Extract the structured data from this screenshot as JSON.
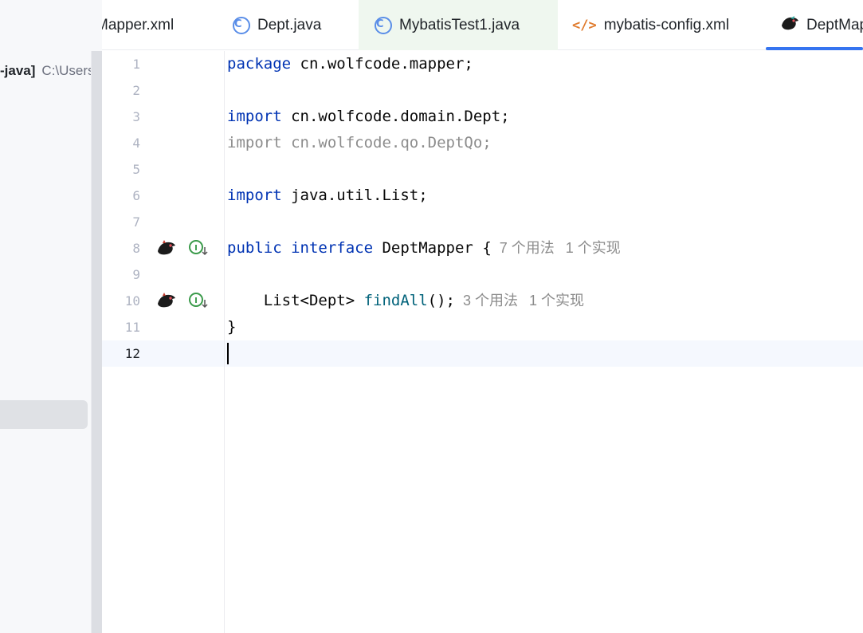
{
  "sidebar": {
    "project_name": "-java]",
    "project_path": "C:\\Users\\"
  },
  "tabs": [
    {
      "label": "Mapper.xml",
      "icon": "xml-file-icon"
    },
    {
      "label": "Dept.java",
      "icon": "class-icon"
    },
    {
      "label": "MybatisTest1.java",
      "icon": "class-icon"
    },
    {
      "label": "mybatis-config.xml",
      "icon": "xml-file-icon"
    },
    {
      "label": "DeptMap",
      "icon": "mybatis-bird-icon"
    }
  ],
  "editor": {
    "line_numbers": [
      "1",
      "2",
      "3",
      "4",
      "5",
      "6",
      "7",
      "8",
      "9",
      "10",
      "11",
      "12"
    ],
    "lines": {
      "l1_kw": "package",
      "l1_rest": " cn.wolfcode.mapper;",
      "l3_kw": "import",
      "l3_rest": " cn.wolfcode.domain.Dept;",
      "l4_text": "import cn.wolfcode.qo.DeptQo;",
      "l6_kw": "import",
      "l6_rest": " java.util.List;",
      "l8_kw1": "public",
      "l8_kw2": "interface",
      "l8_rest": " DeptMapper {",
      "l8_hint_usages": "7 个用法",
      "l8_hint_impl": "1 个实现",
      "l10_pre": "    List<Dept> ",
      "l10_fn": "findAll",
      "l10_post": "();",
      "l10_hint_usages": "3 个用法",
      "l10_hint_impl": "1 个实现",
      "l11_text": "}"
    },
    "current_line": 12,
    "colors": {
      "keyword": "#0033b3",
      "method": "#00627a",
      "unused_import": "#8c8c8c",
      "active_tab_underline": "#3574f0"
    }
  }
}
